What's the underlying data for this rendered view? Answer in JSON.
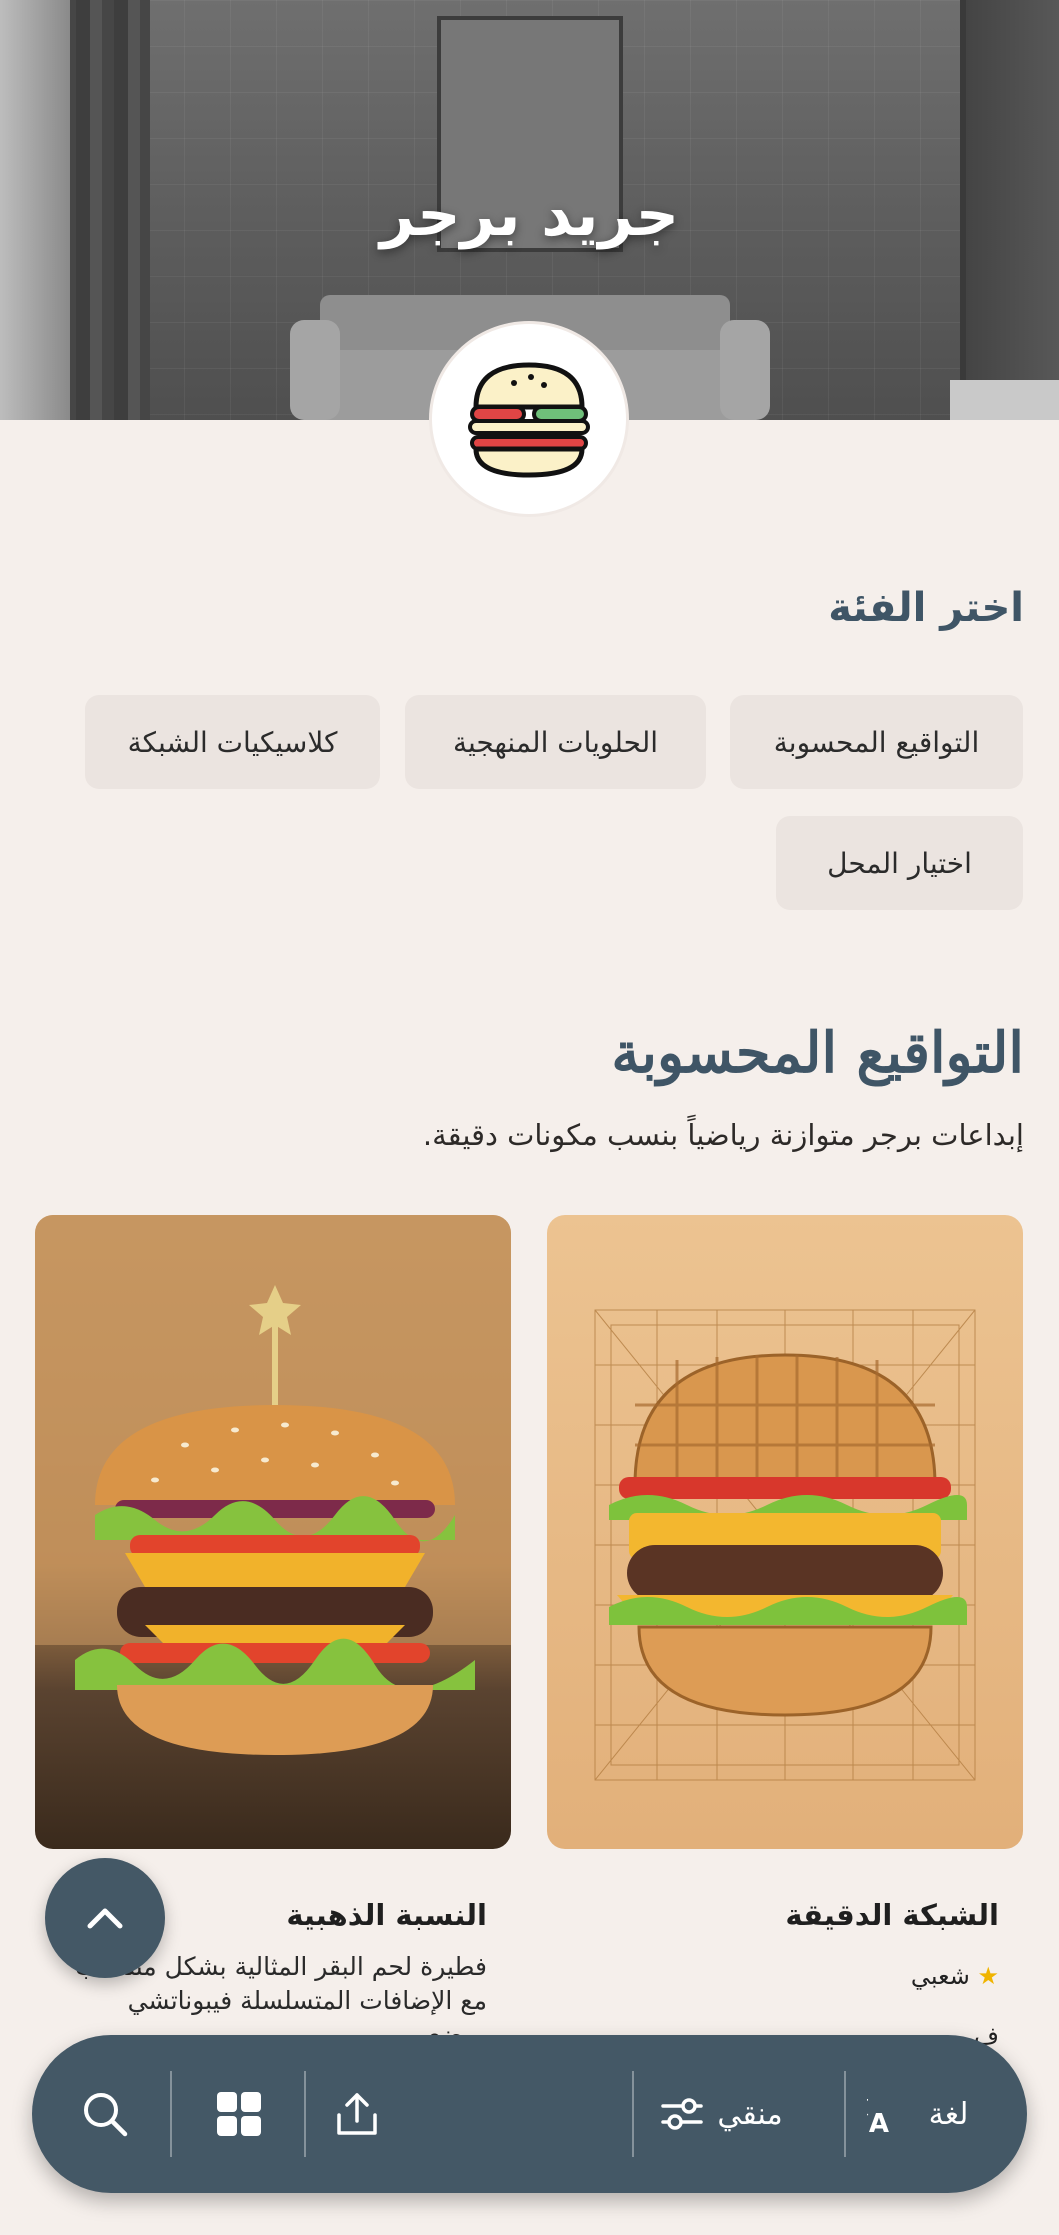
{
  "hero": {
    "title": "جريد برجر",
    "logo_icon": "burger-icon"
  },
  "category_picker": {
    "label": "اختر الفئة",
    "chips": [
      {
        "label": "التواقيع المحسوبة",
        "selected": true
      },
      {
        "label": "الحلويات المنهجية",
        "selected": false
      },
      {
        "label": "كلاسيكيات الشبكة",
        "selected": false
      },
      {
        "label": "اختيار المحل",
        "selected": false
      }
    ]
  },
  "category": {
    "title": "التواقيع المحسوبة",
    "description": "إبداعات برجر متوازنة رياضياً بنسب مكونات دقيقة."
  },
  "items": [
    {
      "title": "الشبكة الدقيقة",
      "badge": "شعبي",
      "badge_icon": "star-icon",
      "partial_text": "ف"
    },
    {
      "title": "النسبة الذهبية",
      "description": "فطيرة لحم البقر المثالية بشكل متناسب مع الإضافات المتسلسلة فيبوناتشي ووضع..."
    }
  ],
  "fab": {
    "icon": "chevron-up-icon"
  },
  "bottom_bar": {
    "language_label": "لغة",
    "language_icon": "translate-icon",
    "filter_label": "منقي",
    "filter_icon": "filter-sliders-icon",
    "share_icon": "share-icon",
    "grid_icon": "grid-icon",
    "search_icon": "search-icon"
  },
  "colors": {
    "background": "#f5efeb",
    "accent": "#445866",
    "heading": "#3f5566",
    "chip": "#ebe4e0",
    "star": "#f0b400"
  }
}
